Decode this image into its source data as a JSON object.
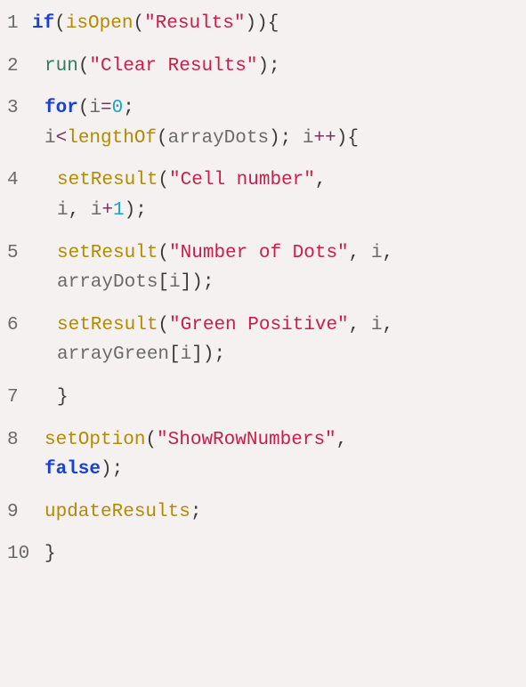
{
  "lines": {
    "l1": {
      "num": "1",
      "kw_if": "if",
      "fn_isOpen": "isOpen",
      "str_Results": "\"Results\""
    },
    "l2": {
      "num": "2",
      "fn_run": "run",
      "str_ClearResults": "\"Clear Results\""
    },
    "l3": {
      "num": "3",
      "kw_for": "for",
      "var_i1": "i",
      "num_0": "0",
      "var_i2": "i",
      "fn_lengthOf": "lengthOf",
      "var_arrayDots": "arrayDots",
      "var_i3": "i"
    },
    "l4": {
      "num": "4",
      "fn_setResult": "setResult",
      "str_CellNumber": "\"Cell number\"",
      "var_i1": "i",
      "var_i2": "i",
      "num_1": "1"
    },
    "l5": {
      "num": "5",
      "fn_setResult": "setResult",
      "str_NumberOfDots": "\"Number of Dots\"",
      "var_i": "i",
      "var_arrayDots": "arrayDots",
      "var_i2": "i"
    },
    "l6": {
      "num": "6",
      "fn_setResult": "setResult",
      "str_GreenPositive": "\"Green Positive\"",
      "var_i": "i",
      "var_arrayGreen": "arrayGreen",
      "var_i2": "i"
    },
    "l7": {
      "num": "7",
      "brace": "}"
    },
    "l8": {
      "num": "8",
      "fn_setOption": "setOption",
      "str_ShowRowNumbers": "\"ShowRowNumbers\"",
      "kw_false": "false"
    },
    "l9": {
      "num": "9",
      "fn_updateResults": "updateResults"
    },
    "l10": {
      "num": "10",
      "brace": "}"
    }
  }
}
